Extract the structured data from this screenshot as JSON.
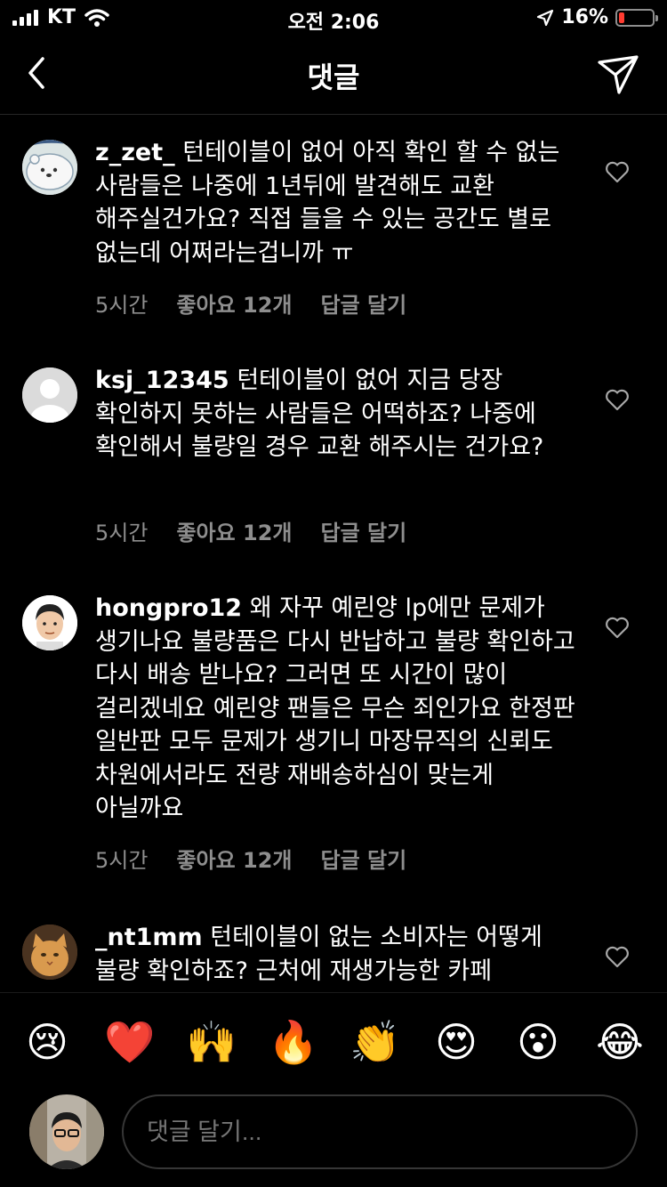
{
  "status_bar": {
    "carrier": "KT",
    "time": "오전 2:06",
    "battery_percent": "16%",
    "battery_level": 0.16
  },
  "header": {
    "title": "댓글"
  },
  "comments": [
    {
      "username": "z_zet_",
      "text": "턴테이블이 없어 아직 확인 할 수 없는 사람들은 나중에 1년뒤에 발견해도 교환 해주실건가요? 직접 들을 수 있는 공간도 별로 없는데 어쩌라는겁니까 ㅠ",
      "time": "5시간",
      "likes": "좋아요 12개",
      "reply": "답글 달기"
    },
    {
      "username": "ksj_12345",
      "text": "턴테이블이 없어 지금 당장 확인하지 못하는 사람들은 어떡하죠? 나중에 확인해서 불량일 경우 교환 해주시는 건가요?",
      "time": "5시간",
      "likes": "좋아요 12개",
      "reply": "답글 달기"
    },
    {
      "username": "hongpro12",
      "text": "왜 자꾸 예린양 lp에만 문제가 생기나요 불량품은 다시 반납하고 불량 확인하고 다시 배송 받나요? 그러면 또 시간이 많이 걸리겠네요 예린양  팬들은 무슨 죄인가요 한정판 일반판 모두 문제가 생기니 마장뮤직의 신뢰도 차원에서라도 전량 재배송하심이 맞는게 아닐까요",
      "time": "5시간",
      "likes": "좋아요 12개",
      "reply": "답글 달기"
    },
    {
      "username": "_nt1mm",
      "text": "턴테이블이 없는 소비자는 어떻게 불량 확인하죠? 근처에 재생가능한 카페"
    }
  ],
  "emoji_bar": [
    "😢",
    "❤️",
    "🙌",
    "🔥",
    "👏",
    "😍",
    "😮",
    "😂"
  ],
  "input": {
    "placeholder": "댓글 달기..."
  },
  "icons": {
    "back": "chevron-left-icon",
    "share": "paper-plane-icon",
    "like": "heart-outline-icon"
  }
}
